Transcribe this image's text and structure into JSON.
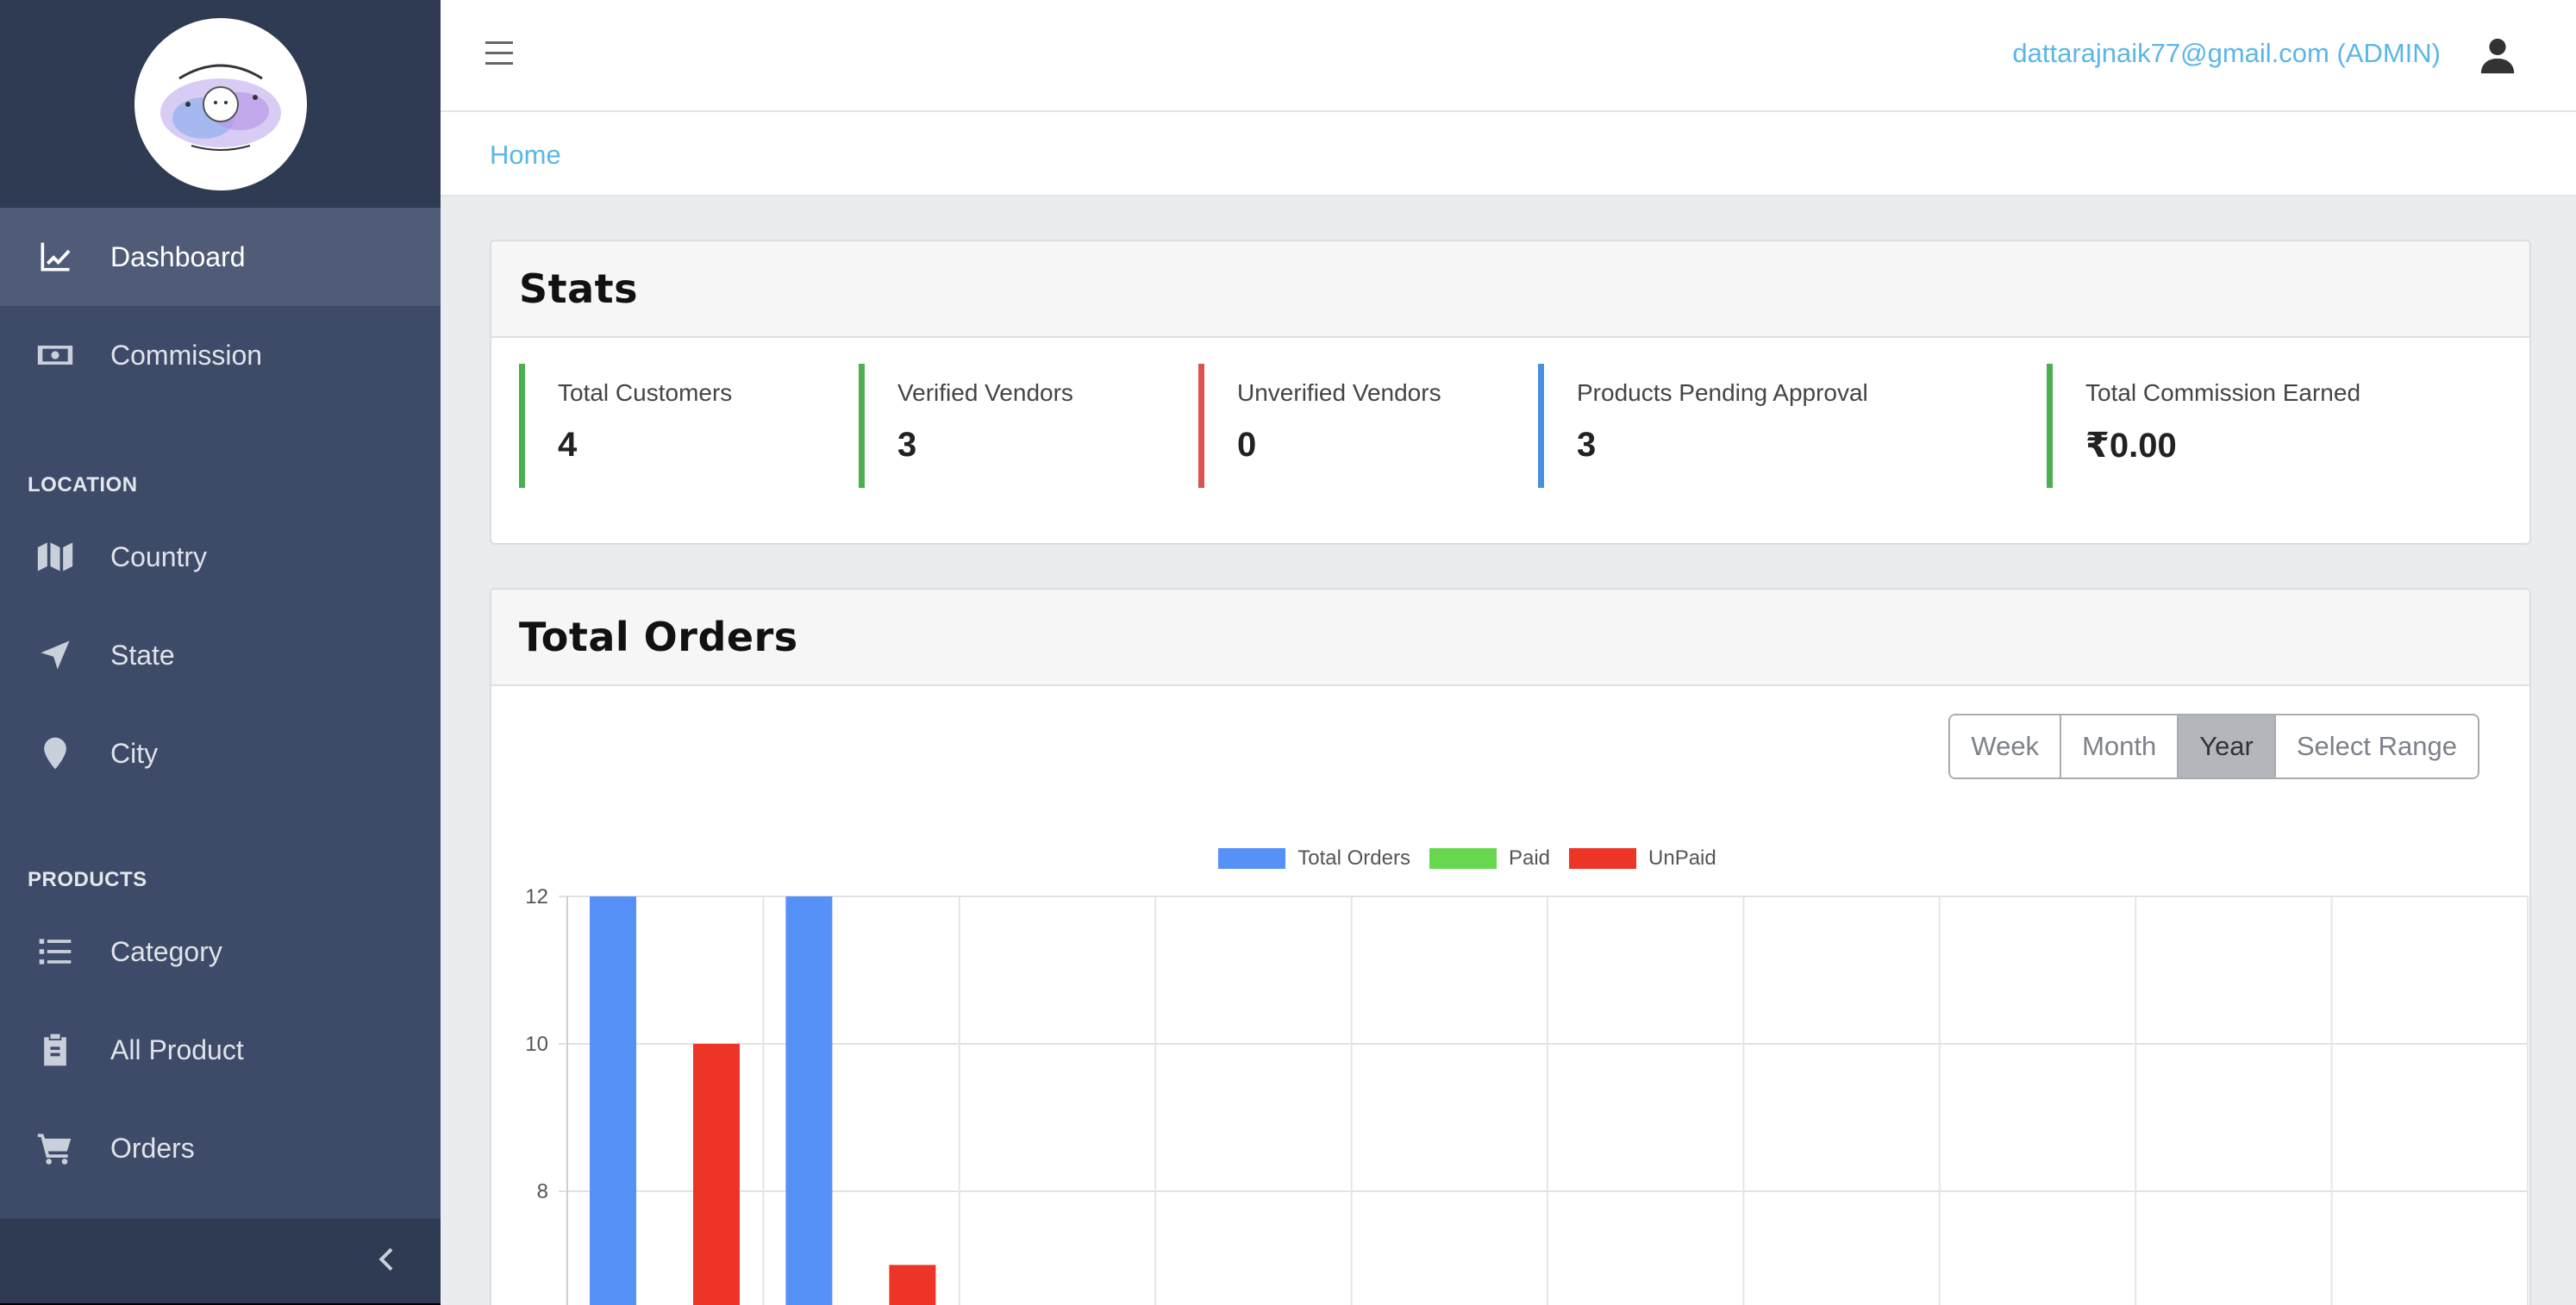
{
  "sidebar": {
    "items": [
      {
        "label": "Dashboard",
        "icon": "chart-line-icon",
        "active": true
      },
      {
        "label": "Commission",
        "icon": "money-bill-icon"
      }
    ],
    "section_location": "LOCATION",
    "location_items": [
      {
        "label": "Country",
        "icon": "map-icon"
      },
      {
        "label": "State",
        "icon": "location-arrow-icon"
      },
      {
        "label": "City",
        "icon": "map-pin-icon"
      }
    ],
    "section_products": "PRODUCTS",
    "product_items": [
      {
        "label": "Category",
        "icon": "list-icon"
      },
      {
        "label": "All Product",
        "icon": "clipboard-icon"
      },
      {
        "label": "Orders",
        "icon": "cart-icon"
      }
    ],
    "collapse_icon": "chevron-left-icon"
  },
  "topbar": {
    "user_email": "dattarajnaik77@gmail.com (ADMIN)",
    "user_icon": "user-icon",
    "menu_icon": "hamburger-icon"
  },
  "breadcrumb": {
    "home": "Home"
  },
  "stats": {
    "title": "Stats",
    "items": [
      {
        "label": "Total Customers",
        "value": "4",
        "color": "#4caf50"
      },
      {
        "label": "Verified Vendors",
        "value": "3",
        "color": "#4caf50"
      },
      {
        "label": "Unverified Vendors",
        "value": "0",
        "color": "#d9534f"
      },
      {
        "label": "Products Pending Approval",
        "value": "3",
        "color": "#4a90e2"
      },
      {
        "label": "Total Commission Earned",
        "value": "₹0.00",
        "color": "#4caf50"
      }
    ]
  },
  "orders": {
    "title": "Total Orders",
    "ranges": [
      "Week",
      "Month",
      "Year",
      "Select Range"
    ],
    "active_range": "Year"
  },
  "chart_data": {
    "type": "bar",
    "series": [
      {
        "name": "Total Orders",
        "color": "#5591f6",
        "values": [
          12,
          12,
          0,
          0,
          0,
          0,
          0,
          0,
          0,
          0
        ]
      },
      {
        "name": "Paid",
        "color": "#67d84e",
        "values": [
          0,
          0,
          0,
          0,
          0,
          0,
          0,
          0,
          0,
          0
        ]
      },
      {
        "name": "UnPaid",
        "color": "#ec3526",
        "values": [
          10,
          7,
          0,
          0,
          0,
          0,
          0,
          0,
          0,
          0
        ]
      }
    ],
    "y_ticks": [
      "12",
      "10",
      "8"
    ],
    "ylim": [
      6.3,
      12
    ],
    "grid": true,
    "legend": "top-center"
  }
}
